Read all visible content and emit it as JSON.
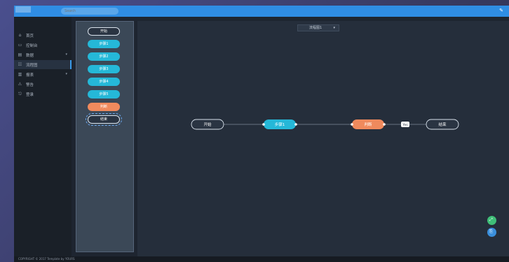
{
  "header": {
    "logo_text": "",
    "search_placeholder": "Search",
    "settings_icon": "wrench-icon"
  },
  "sidebar": {
    "items": [
      {
        "icon": "⌂",
        "label": "首页",
        "arrow": ""
      },
      {
        "icon": "▭",
        "label": "控制台",
        "arrow": ""
      },
      {
        "icon": "▤",
        "label": "数据",
        "arrow": "▾"
      },
      {
        "icon": "☷",
        "label": "流程图",
        "arrow": ""
      },
      {
        "icon": "▥",
        "label": "报表",
        "arrow": "▾"
      },
      {
        "icon": "⚠",
        "label": "警告",
        "arrow": ""
      },
      {
        "icon": "⎋",
        "label": "登录",
        "arrow": ""
      }
    ]
  },
  "palette": {
    "nodes": [
      {
        "label": "开始",
        "kind": "start"
      },
      {
        "label": "步骤1",
        "kind": "cyan"
      },
      {
        "label": "步骤2",
        "kind": "cyan"
      },
      {
        "label": "步骤3",
        "kind": "cyan"
      },
      {
        "label": "步骤4",
        "kind": "cyan"
      },
      {
        "label": "步骤5",
        "kind": "cyan"
      },
      {
        "label": "判断",
        "kind": "orange"
      },
      {
        "label": "结束",
        "kind": "end"
      }
    ]
  },
  "canvas": {
    "dropdown_value": "流程图1",
    "dropdown_caret": "▾",
    "flow_nodes": [
      {
        "label": "开始",
        "kind": "start"
      },
      {
        "label": "步骤1",
        "kind": "cyan"
      },
      {
        "label": "判断",
        "kind": "orange"
      },
      {
        "label": "结束",
        "kind": "end"
      }
    ],
    "edge_label": "Yes"
  },
  "fabs": [
    {
      "icon": "⤢",
      "color": "#3fbf78"
    },
    {
      "icon": "⎘",
      "color": "#3a8fdc"
    }
  ],
  "footer": {
    "copyright": "COPYRIGHT © 2017 Template by YOURS"
  },
  "colors": {
    "header": "#2f8de4",
    "accent_cyan": "#25b8d8",
    "accent_orange": "#f08a5d"
  }
}
